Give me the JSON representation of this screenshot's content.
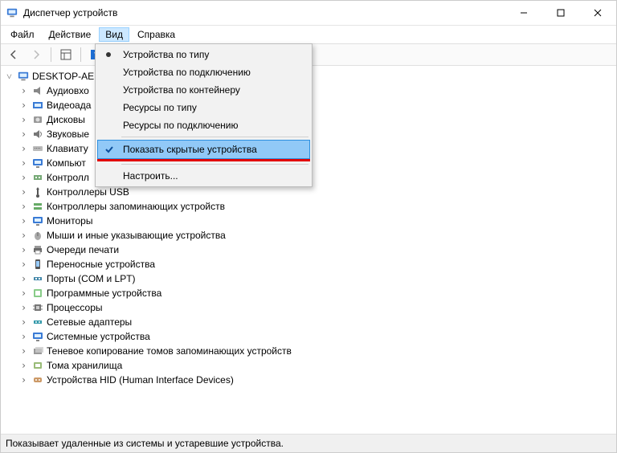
{
  "title": "Диспетчер устройств",
  "menu": {
    "file": "Файл",
    "action": "Действие",
    "view": "Вид",
    "help": "Справка"
  },
  "view_menu": {
    "by_type": "Устройства по типу",
    "by_connection": "Устройства по подключению",
    "by_container": "Устройства по контейнеру",
    "resources_by_type": "Ресурсы по типу",
    "resources_by_connection": "Ресурсы по подключению",
    "show_hidden": "Показать скрытые устройства",
    "customize": "Настроить..."
  },
  "tree": {
    "root": "DESKTOP-AE",
    "items": [
      "Аудиовхо",
      "Видеоада",
      "Дисковы",
      "Звуковые",
      "Клавиату",
      "Компьют",
      "Контролл",
      "Контроллеры USB",
      "Контроллеры запоминающих устройств",
      "Мониторы",
      "Мыши и иные указывающие устройства",
      "Очереди печати",
      "Переносные устройства",
      "Порты (COM и LPT)",
      "Программные устройства",
      "Процессоры",
      "Сетевые адаптеры",
      "Системные устройства",
      "Теневое копирование томов запоминающих устройств",
      "Тома хранилища",
      "Устройства HID (Human Interface Devices)"
    ]
  },
  "icons": [
    "audio",
    "video",
    "disk",
    "sound",
    "keyboard",
    "computer",
    "controller",
    "usb",
    "storage",
    "monitor",
    "mouse",
    "printer",
    "portable",
    "ports",
    "software",
    "cpu",
    "network",
    "system",
    "shadow",
    "volume",
    "hid"
  ],
  "statusbar": "Показывает удаленные из системы и устаревшие устройства."
}
